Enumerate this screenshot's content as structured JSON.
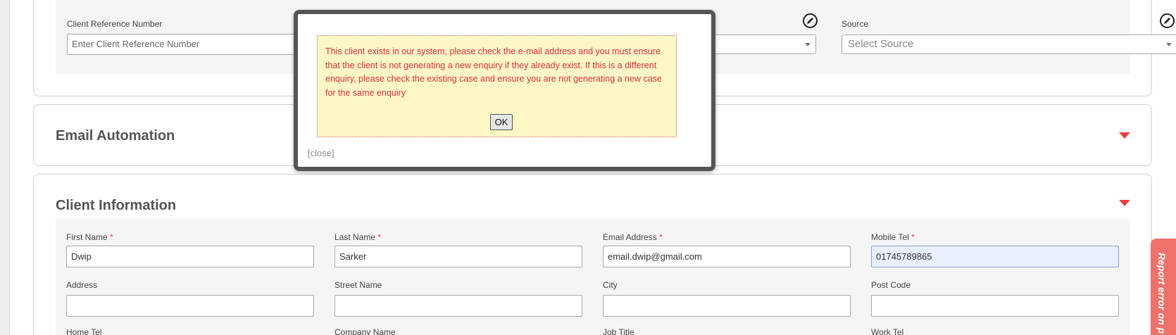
{
  "top_section": {
    "client_ref_label": "Client Reference Number",
    "client_ref_placeholder": "Enter Client Reference Number",
    "source_label": "Source",
    "source_placeholder": "Select Source"
  },
  "email_automation": {
    "title": "Email Automation"
  },
  "client_information": {
    "title": "Client Information",
    "fields": {
      "first_name": {
        "label": "First Name",
        "value": "Dwip"
      },
      "last_name": {
        "label": "Last Name",
        "value": "Sarker"
      },
      "email": {
        "label": "Email Address",
        "value": "email.dwip@gmail.com"
      },
      "mobile": {
        "label": "Mobile Tel",
        "value": "01745789865"
      },
      "address": {
        "label": "Address",
        "value": ""
      },
      "street": {
        "label": "Street Name",
        "value": ""
      },
      "city": {
        "label": "City",
        "value": ""
      },
      "post_code": {
        "label": "Post Code",
        "value": ""
      },
      "home_tel": {
        "label": "Home Tel"
      },
      "company": {
        "label": "Company Name"
      },
      "job_title": {
        "label": "Job Title"
      },
      "work_tel": {
        "label": "Work Tel"
      }
    },
    "required_mark": "*"
  },
  "modal": {
    "message": "This client exists in our system, please check the e-mail address and you must ensure that the client is not generating a new enquiry if they already exist. If this is a different enquiry, please check the existing case and ensure you are not generating a new case for the same enquiry",
    "ok_label": "OK",
    "close_label": "[close]"
  },
  "report_tab": {
    "label": "Report error on p"
  },
  "icons": {
    "edit": "pencil-circle-icon",
    "expand": "caret-down-icon"
  },
  "colors": {
    "accent_red": "#e8403f",
    "alert_bg": "#fdf6c5",
    "alert_text": "#d9323f",
    "highlight_input": "#e8f0fe"
  }
}
